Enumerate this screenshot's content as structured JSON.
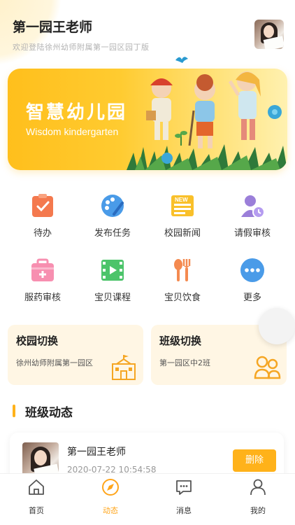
{
  "header": {
    "title": "第一园王老师",
    "subtitle": "欢迎登陆徐州幼师附属第一园区园丁版"
  },
  "banner": {
    "title": "智慧幼儿园",
    "subtitle": "Wisdom kindergarten"
  },
  "grid": [
    {
      "label": "待办",
      "icon": "clipboard-check-icon"
    },
    {
      "label": "发布任务",
      "icon": "palette-icon"
    },
    {
      "label": "校园新闻",
      "icon": "newspaper-icon",
      "badge": "NEW"
    },
    {
      "label": "请假审核",
      "icon": "user-clock-icon"
    },
    {
      "label": "服药审核",
      "icon": "medicine-box-icon"
    },
    {
      "label": "宝贝课程",
      "icon": "film-icon"
    },
    {
      "label": "宝贝饮食",
      "icon": "spoon-fork-icon"
    },
    {
      "label": "更多",
      "icon": "more-dots-icon"
    }
  ],
  "campus_switch": {
    "title": "校园切换",
    "value": "徐州幼师附属第一园区"
  },
  "class_switch": {
    "title": "班级切换",
    "value": "第一园区中2班"
  },
  "section": {
    "title": "班级动态"
  },
  "post": {
    "author": "第一园王老师",
    "time": "2020-07-22 10:54:58",
    "delete_label": "删除"
  },
  "tabbar": [
    {
      "label": "首页",
      "icon": "home-icon",
      "active": false
    },
    {
      "label": "动态",
      "icon": "compass-icon",
      "active": true
    },
    {
      "label": "消息",
      "icon": "message-icon",
      "active": false
    },
    {
      "label": "我的",
      "icon": "user-icon",
      "active": false
    }
  ],
  "colors": {
    "accent": "#ffb21a",
    "active_tab": "#ffa51a",
    "banner_start": "#ffbf1c",
    "card_bg": "#fff6e4"
  }
}
